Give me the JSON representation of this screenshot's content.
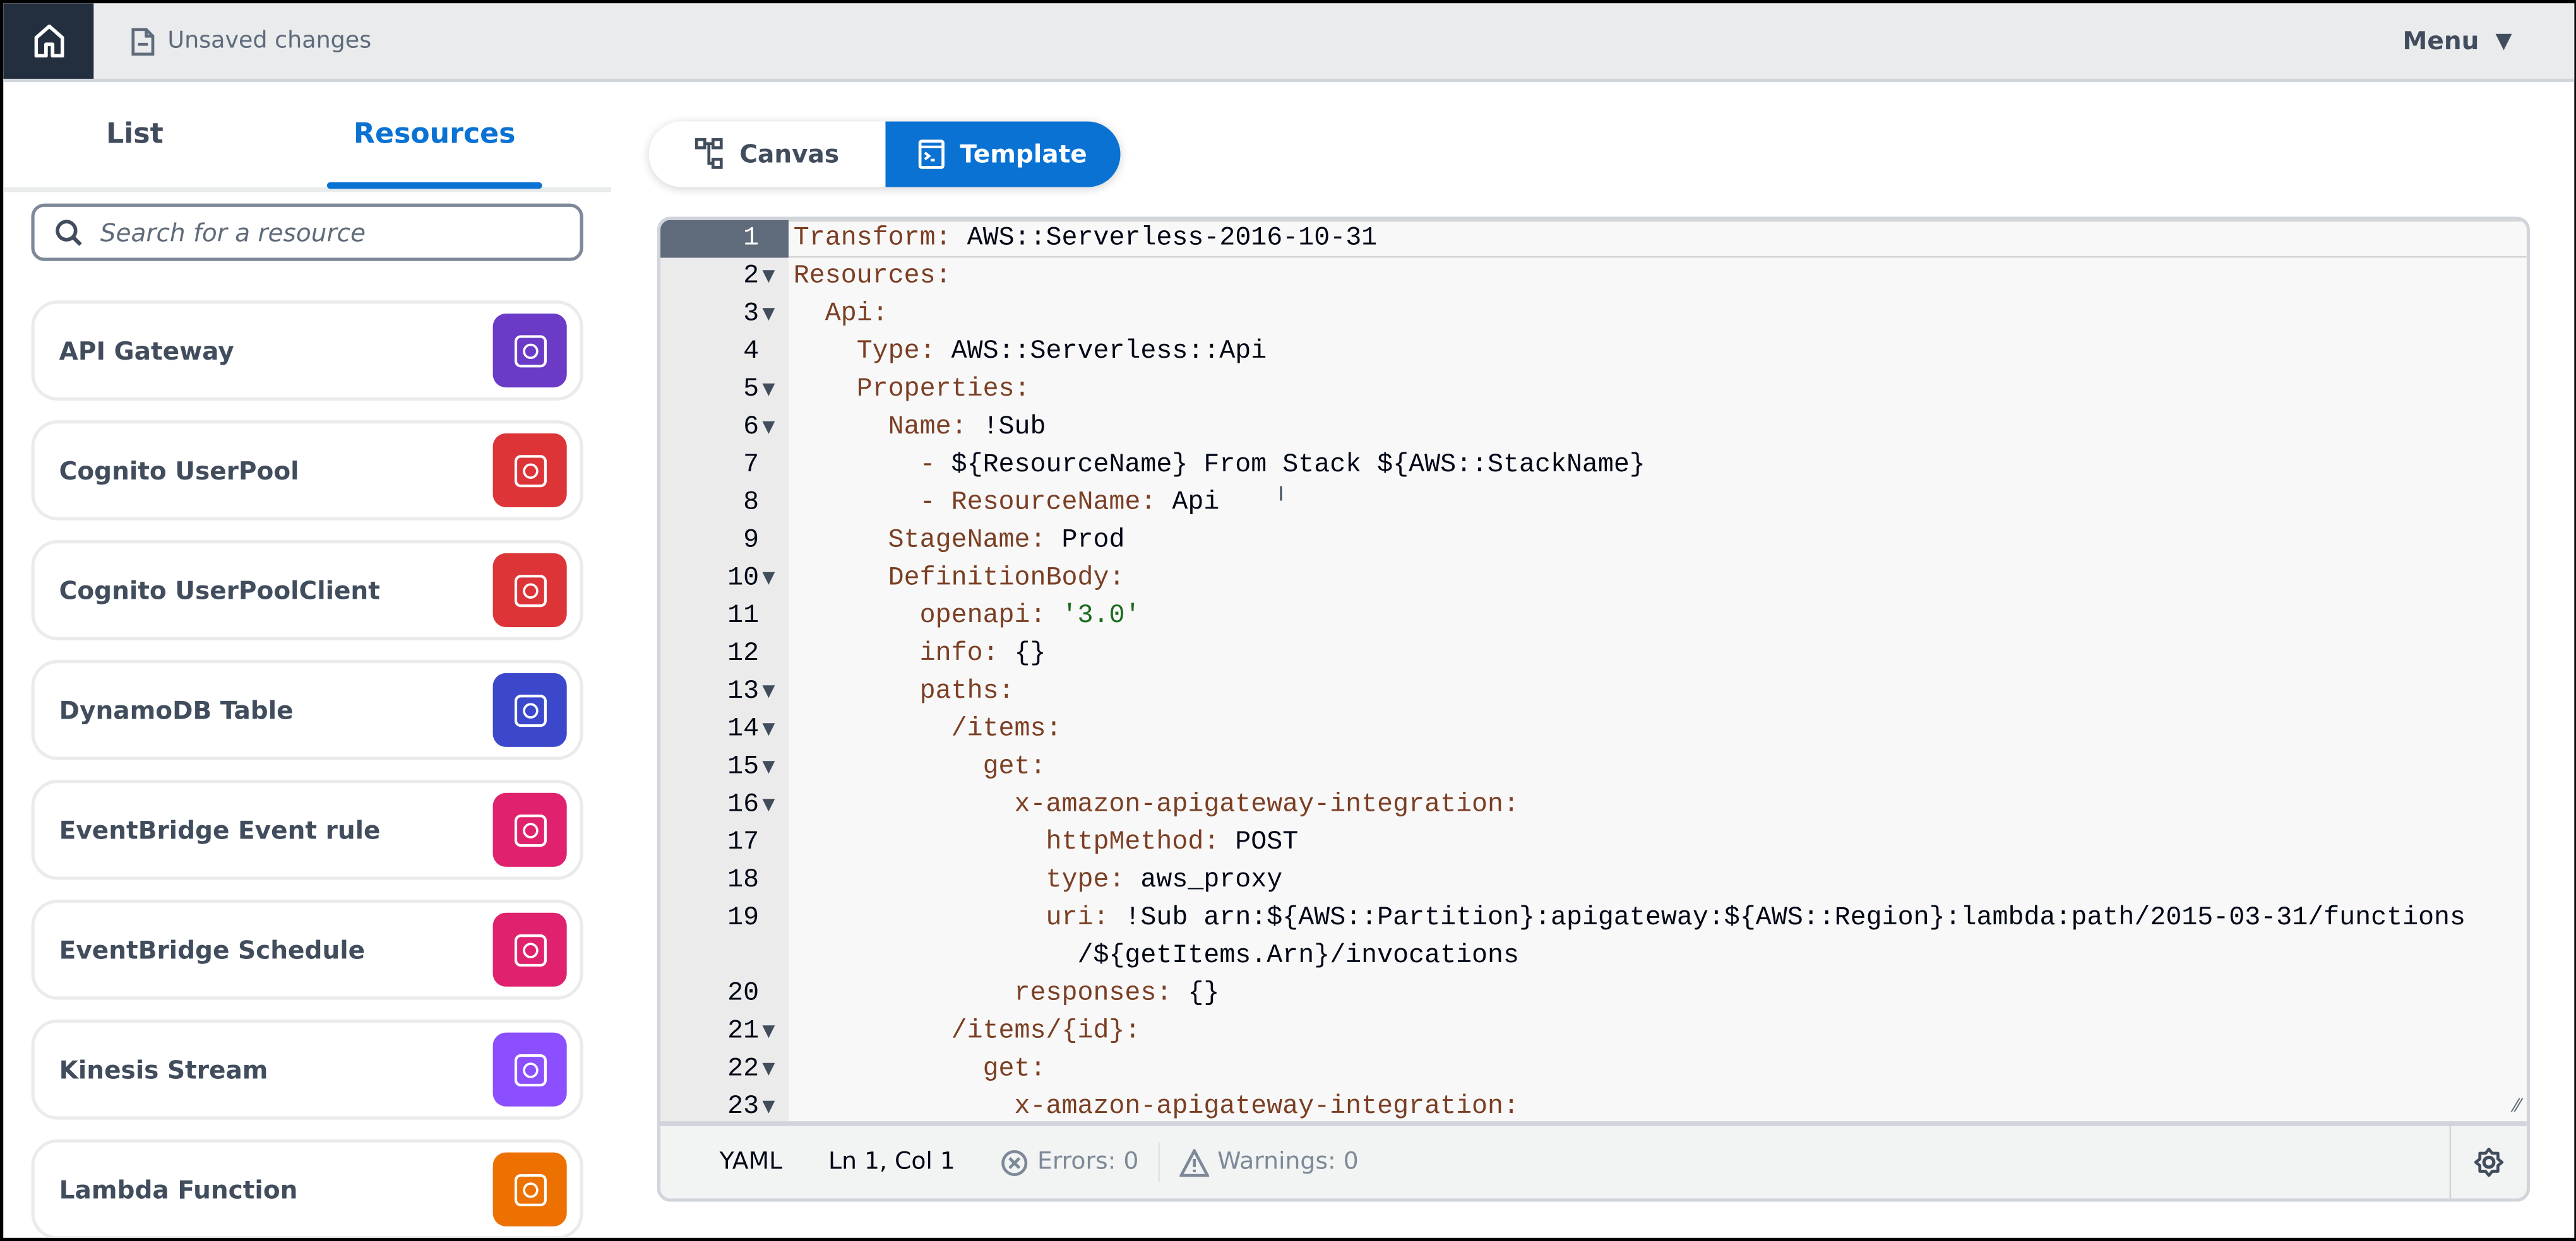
{
  "topbar": {
    "status": "Unsaved changes",
    "menu_label": "Menu"
  },
  "sidebar": {
    "tabs": [
      {
        "label": "List"
      },
      {
        "label": "Resources"
      }
    ],
    "search_placeholder": "Search for a resource",
    "resources": [
      {
        "label": "API Gateway",
        "color": "#6b3ac6",
        "icon": "api-gateway-icon"
      },
      {
        "label": "Cognito UserPool",
        "color": "#dd3437",
        "icon": "cognito-icon"
      },
      {
        "label": "Cognito UserPoolClient",
        "color": "#dd3437",
        "icon": "cognito-icon"
      },
      {
        "label": "DynamoDB Table",
        "color": "#3b48cc",
        "icon": "dynamodb-icon"
      },
      {
        "label": "EventBridge Event rule",
        "color": "#e0226e",
        "icon": "eventbridge-icon"
      },
      {
        "label": "EventBridge Schedule",
        "color": "#e0226e",
        "icon": "eventbridge-icon"
      },
      {
        "label": "Kinesis Stream",
        "color": "#8c4fff",
        "icon": "kinesis-icon"
      },
      {
        "label": "Lambda Function",
        "color": "#ed7100",
        "icon": "lambda-icon"
      }
    ]
  },
  "view_toggle": {
    "canvas": "Canvas",
    "template": "Template",
    "active": "Template"
  },
  "editor": {
    "lines": [
      {
        "n": "1",
        "f": false,
        "i": 0,
        "p": [
          [
            "k",
            "Transform: "
          ],
          [
            "v",
            "AWS::Serverless-2016-10-31"
          ]
        ]
      },
      {
        "n": "2",
        "f": true,
        "i": 0,
        "p": [
          [
            "k",
            "Resources:"
          ]
        ]
      },
      {
        "n": "3",
        "f": true,
        "i": 2,
        "p": [
          [
            "k",
            "Api:"
          ]
        ]
      },
      {
        "n": "4",
        "f": false,
        "i": 4,
        "p": [
          [
            "k",
            "Type: "
          ],
          [
            "v",
            "AWS::Serverless::Api"
          ]
        ]
      },
      {
        "n": "5",
        "f": true,
        "i": 4,
        "p": [
          [
            "k",
            "Properties:"
          ]
        ]
      },
      {
        "n": "6",
        "f": true,
        "i": 6,
        "p": [
          [
            "k",
            "Name: "
          ],
          [
            "v",
            "!Sub"
          ]
        ]
      },
      {
        "n": "7",
        "f": false,
        "i": 8,
        "p": [
          [
            "k",
            "- "
          ],
          [
            "v",
            "${ResourceName} From Stack ${AWS::StackName}"
          ]
        ]
      },
      {
        "n": "8",
        "f": false,
        "i": 8,
        "p": [
          [
            "k",
            "- ResourceName: "
          ],
          [
            "v",
            "Api"
          ]
        ]
      },
      {
        "n": "9",
        "f": false,
        "i": 6,
        "p": [
          [
            "k",
            "StageName: "
          ],
          [
            "v",
            "Prod"
          ]
        ]
      },
      {
        "n": "10",
        "f": true,
        "i": 6,
        "p": [
          [
            "k",
            "DefinitionBody:"
          ]
        ]
      },
      {
        "n": "11",
        "f": false,
        "i": 8,
        "p": [
          [
            "k",
            "openapi: "
          ],
          [
            "s",
            "'3.0'"
          ]
        ]
      },
      {
        "n": "12",
        "f": false,
        "i": 8,
        "p": [
          [
            "k",
            "info: "
          ],
          [
            "v",
            "{}"
          ]
        ]
      },
      {
        "n": "13",
        "f": true,
        "i": 8,
        "p": [
          [
            "k",
            "paths:"
          ]
        ]
      },
      {
        "n": "14",
        "f": true,
        "i": 10,
        "p": [
          [
            "k",
            "/items:"
          ]
        ]
      },
      {
        "n": "15",
        "f": true,
        "i": 12,
        "p": [
          [
            "k",
            "get:"
          ]
        ]
      },
      {
        "n": "16",
        "f": true,
        "i": 14,
        "p": [
          [
            "k",
            "x-amazon-apigateway-integration:"
          ]
        ]
      },
      {
        "n": "17",
        "f": false,
        "i": 16,
        "p": [
          [
            "k",
            "httpMethod: "
          ],
          [
            "v",
            "POST"
          ]
        ]
      },
      {
        "n": "18",
        "f": false,
        "i": 16,
        "p": [
          [
            "k",
            "type: "
          ],
          [
            "v",
            "aws_proxy"
          ]
        ]
      },
      {
        "n": "19",
        "f": false,
        "i": 16,
        "p": [
          [
            "k",
            "uri: "
          ],
          [
            "v",
            "!Sub arn:${AWS::Partition}:apigateway:${AWS::Region}:lambda:path/2015-03-31/functions"
          ]
        ]
      },
      {
        "n": "",
        "f": false,
        "i": 18,
        "p": [
          [
            "v",
            "/${getItems.Arn}/invocations"
          ]
        ]
      },
      {
        "n": "20",
        "f": false,
        "i": 14,
        "p": [
          [
            "k",
            "responses: "
          ],
          [
            "v",
            "{}"
          ]
        ]
      },
      {
        "n": "21",
        "f": true,
        "i": 10,
        "p": [
          [
            "k",
            "/items/{id}:"
          ]
        ]
      },
      {
        "n": "22",
        "f": true,
        "i": 12,
        "p": [
          [
            "k",
            "get:"
          ]
        ]
      },
      {
        "n": "23",
        "f": true,
        "i": 14,
        "p": [
          [
            "k",
            "x-amazon-apigateway-integration:"
          ]
        ]
      }
    ],
    "footer": {
      "language": "YAML",
      "position": "Ln 1, Col 1",
      "errors": "Errors: 0",
      "warnings": "Warnings: 0"
    }
  }
}
